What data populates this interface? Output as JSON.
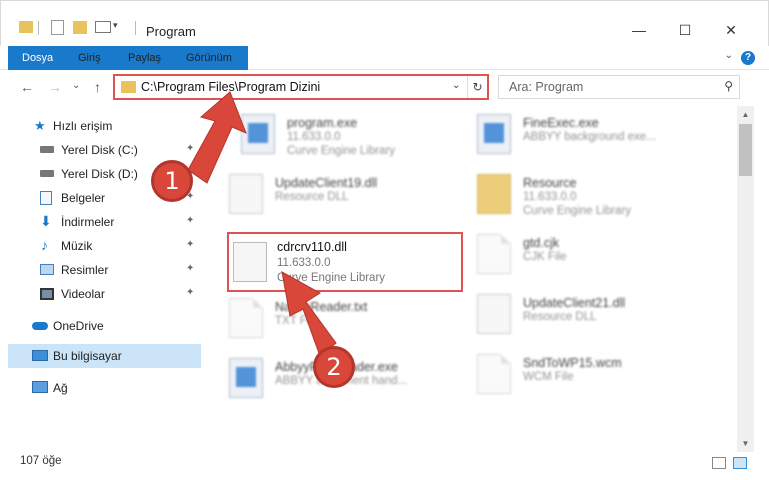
{
  "window": {
    "title": "Program",
    "minimize_glyph": "—",
    "maximize_glyph": "☐",
    "close_glyph": "✕"
  },
  "ribbon": {
    "tabs": [
      "Dosya",
      "Giriş",
      "Paylaş",
      "Görünüm"
    ],
    "help": "?",
    "chevron": "⌄"
  },
  "nav": {
    "back": "←",
    "forward": "→",
    "recent": "⌄",
    "up": "↑",
    "address": "C:\\Program Files\\Program Dizini",
    "address_dropdown": "⌄",
    "refresh": "↻",
    "search_placeholder": "Ara: Program",
    "search_icon": "⚲"
  },
  "sidebar": {
    "items": [
      {
        "label": "Hızlı erişim",
        "icon": "star-icon"
      },
      {
        "label": "Yerel Disk (C:)",
        "icon": "drive-icon",
        "pinned": true
      },
      {
        "label": "Yerel Disk (D:)",
        "icon": "drive-icon",
        "pinned": true
      },
      {
        "label": "Belgeler",
        "icon": "documents-icon",
        "pinned": true
      },
      {
        "label": "İndirmeler",
        "icon": "download-icon",
        "pinned": true
      },
      {
        "label": "Müzik",
        "icon": "music-icon",
        "pinned": true
      },
      {
        "label": "Resimler",
        "icon": "pictures-icon",
        "pinned": true
      },
      {
        "label": "Videolar",
        "icon": "videos-icon",
        "pinned": true
      },
      {
        "label": "OneDrive",
        "icon": "cloud-icon"
      },
      {
        "label": "Bu bilgisayar",
        "icon": "computer-icon",
        "selected": true
      },
      {
        "label": "Ağ",
        "icon": "network-icon"
      }
    ],
    "pin_glyph": "📌"
  },
  "files": {
    "left": [
      {
        "name": "program.exe",
        "ver": "11.633.0.0",
        "desc": "Curve Engine Library",
        "icon": "app-icon"
      },
      {
        "name": "UpdateClient19.dll",
        "ver": "",
        "desc": "Resource DLL",
        "icon": "gear-file-icon"
      },
      {
        "name": "cdrcrv110.dll",
        "ver": "11.633.0.0",
        "desc": "Curve Engine Library",
        "icon": "gear-file-icon",
        "highlight": true
      },
      {
        "name": "NativeReader.txt",
        "ver": "",
        "desc": "TXT File",
        "icon": "document-icon"
      },
      {
        "name": "AbbyyFineReader.exe",
        "ver": "",
        "desc": "ABBYY Document hand...",
        "icon": "app-icon"
      }
    ],
    "right": [
      {
        "name": "FineExec.exe",
        "ver": "",
        "desc": "ABBYY background exe...",
        "icon": "app-icon"
      },
      {
        "name": "Resource",
        "ver": "11.633.0.0",
        "desc": "Curve Engine Library",
        "icon": "folder-icon"
      },
      {
        "name": "gtd.cjk",
        "ver": "",
        "desc": "CJK File",
        "icon": "document-icon"
      },
      {
        "name": "UpdateClient21.dll",
        "ver": "",
        "desc": "Resource DLL",
        "icon": "gear-file-icon"
      },
      {
        "name": "SndToWP15.wcm",
        "ver": "",
        "desc": "WCM File",
        "icon": "document-icon"
      }
    ]
  },
  "status": {
    "count": "107 öğe"
  },
  "callouts": {
    "one": "1",
    "two": "2"
  },
  "colors": {
    "accent": "#1979ca",
    "highlight_red": "#e05252",
    "callout_red": "#d9463a",
    "selection": "#cce4f7"
  }
}
